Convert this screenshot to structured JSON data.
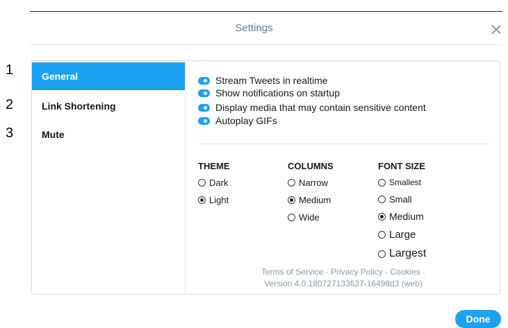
{
  "header": {
    "title": "Settings"
  },
  "annotations": [
    "1",
    "2",
    "3"
  ],
  "sidebar": {
    "items": [
      {
        "label": "General",
        "active": true
      },
      {
        "label": "Link Shortening",
        "active": false
      },
      {
        "label": "Mute",
        "active": false
      }
    ]
  },
  "toggles": [
    {
      "label": "Stream Tweets in realtime",
      "on": true
    },
    {
      "label": "Show notifications on startup",
      "on": true
    },
    {
      "label": "Display media that may contain sensitive content",
      "on": true
    },
    {
      "label": "Autoplay GIFs",
      "on": true
    }
  ],
  "theme": {
    "heading": "THEME",
    "options": [
      {
        "label": "Dark",
        "selected": false
      },
      {
        "label": "Light",
        "selected": true
      }
    ]
  },
  "columns": {
    "heading": "COLUMNS",
    "options": [
      {
        "label": "Narrow",
        "selected": false
      },
      {
        "label": "Medium",
        "selected": true
      },
      {
        "label": "Wide",
        "selected": false
      }
    ]
  },
  "font_size": {
    "heading": "FONT SIZE",
    "options": [
      {
        "label": "Smallest",
        "selected": false
      },
      {
        "label": "Small",
        "selected": false
      },
      {
        "label": "Medium",
        "selected": true
      },
      {
        "label": "Large",
        "selected": false
      },
      {
        "label": "Largest",
        "selected": false
      }
    ]
  },
  "footer": {
    "terms": "Terms of Service",
    "privacy": "Privacy Policy",
    "cookies": "Cookies",
    "separator": "·",
    "version": "Version 4.0.180727133627-16498d3 (web)"
  },
  "done_label": "Done",
  "colors": {
    "accent": "#1da1f2",
    "muted": "#8899a6"
  }
}
